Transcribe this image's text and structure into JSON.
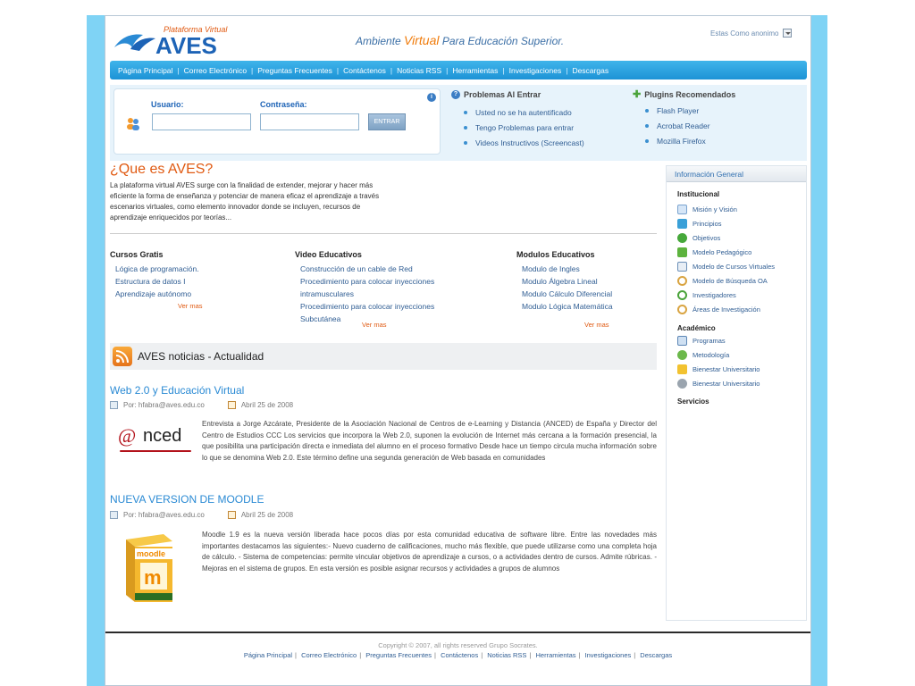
{
  "header": {
    "logo_subtitle": "Plataforma Virtual",
    "logo_title": "AVES",
    "tagline_pre": "Ambiente",
    "tagline_highlight": "Virtual",
    "tagline_post": "Para Educación Superior.",
    "user_state": "Estas Como anonimo"
  },
  "nav": [
    "Página Principal",
    "Correo Electrónico",
    "Preguntas Frecuentes",
    "Contáctenos",
    "Noticias RSS",
    "Herramientas",
    "Investigaciones",
    "Descargas"
  ],
  "login": {
    "user_label": "Usuario:",
    "password_label": "Contraseña:",
    "user_value": "",
    "password_value": "",
    "submit_label": "ENTRAR"
  },
  "problems": {
    "title": "Problemas Al Entrar",
    "items": [
      "Usted no se ha autentificado",
      "Tengo Problemas para entrar",
      "Videos Instructivos (Screencast)"
    ]
  },
  "plugins": {
    "title": "Plugins Recomendados",
    "items": [
      "Flash Player",
      "Acrobat Reader",
      "Mozilla Firefox"
    ]
  },
  "about": {
    "title": "¿Que es AVES?",
    "text": "La plataforma virtual AVES surge con la finalidad de extender, mejorar y hacer más eficiente la forma de enseñanza y potenciar de manera eficaz el aprendizaje a través escenarios virtuales, como elemento innovador donde se incluyen, recursos de aprendizaje enriquecidos por teorías..."
  },
  "categories": [
    {
      "title": "Cursos Gratis",
      "items": [
        "Lógica de programación.",
        "Estructura de datos I",
        "Aprendizaje autónomo"
      ],
      "more": "Ver mas"
    },
    {
      "title": "Video Educativos",
      "items": [
        "Construcción de un cable de Red",
        "Procedimiento para colocar inyecciones intramusculares",
        "Procedimiento para colocar inyecciones Subcutánea"
      ],
      "more": "Ver mas"
    },
    {
      "title": "Modulos Educativos",
      "items": [
        "Modulo de Ingles",
        "Modulo Álgebra Lineal",
        "Modulo Cálculo Diferencial",
        "Modulo Lógica Matemática"
      ],
      "more": "Ver mas"
    }
  ],
  "news": {
    "title": "AVES noticias - Actualidad",
    "articles": [
      {
        "title": "Web 2.0 y Educación Virtual",
        "author": "Por: hfabra@aves.edu.co",
        "date": "Abril 25 de 2008",
        "image_text": "nced",
        "body": "Entrevista a Jorge Azcárate, Presidente de la Asociación Nacional de Centros de e-Learning y Distancia (ANCED) de España y Director del Centro de Estudios CCC Los servicios que incorpora la Web 2.0, suponen la evolución de Internet más cercana a la formación presencial, la que posibilita una participación directa e inmediata del alumno en el proceso formativo Desde hace un tiempo circula mucha información sobre lo que se denomina Web 2.0. Este término define una segunda generación de Web basada en comunidades"
      },
      {
        "title": "NUEVA VERSION DE MOODLE",
        "author": "Por: hfabra@aves.edu.co",
        "date": "Abril 25 de 2008",
        "image_text": "moodle",
        "body": "Moodle 1.9 es la nueva versión liberada hace pocos días por esta comunidad educativa de software libre. Entre las novedades más importantes destacamos las siguientes:- Nuevo cuaderno de calificaciones, mucho más flexible, que puede utilizarse como una completa hoja de cálculo. - Sistema de competencias: permite vincular objetivos de aprendizaje a cursos, o a actividades dentro de cursos. Admite rúbricas. - Mejoras en el sistema de grupos. En esta versión es posible asignar recursos y actividades a grupos de alumnos"
      }
    ]
  },
  "sidebar": {
    "header": "Información General",
    "sections": [
      {
        "title": "Institucional",
        "items": [
          "Misión y Visión",
          "Principios",
          "Objetivos",
          "Modelo Pedagógico",
          "Modelo de Cursos Virtuales",
          "Modelo de Búsqueda OA",
          "Investigadores",
          "Áreas de Investigación"
        ]
      },
      {
        "title": "Académico",
        "items": [
          "Programas",
          "Metodología",
          "Bienestar Universitario",
          "Bienestar Universitario"
        ]
      },
      {
        "title": "Servicios",
        "items": []
      }
    ]
  },
  "footer": {
    "copyright": "Copyright © 2007, all rights reserved Grupo Socrates.",
    "links": [
      "Página Principal",
      "Correo Electrónico",
      "Preguntas Frecuentes",
      "Contáctenos",
      "Noticias RSS",
      "Herramientas",
      "Investigaciones",
      "Descargas"
    ]
  },
  "colors": {
    "background_strip": "#7fd3f5",
    "nav_blue": "#1d93d6",
    "accent_orange": "#e05a12",
    "link_blue": "#2f5d93"
  }
}
